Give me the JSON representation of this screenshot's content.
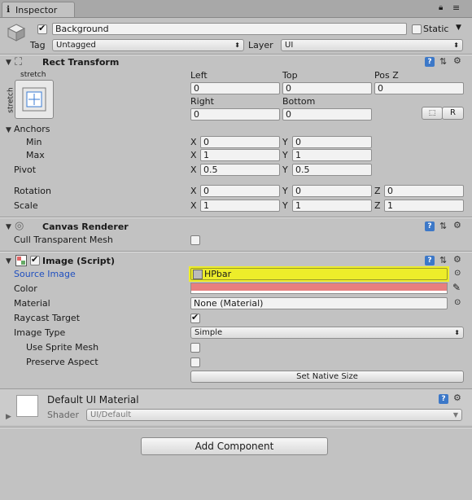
{
  "window": {
    "tab_label": "Inspector",
    "lock_icon": "lock-icon",
    "menu_icon": "context-menu-icon"
  },
  "object": {
    "name": "Background",
    "static_label": "Static",
    "tag_label": "Tag",
    "tag_value": "Untagged",
    "layer_label": "Layer",
    "layer_value": "UI"
  },
  "rect_transform": {
    "title": "Rect Transform",
    "anchor_preset_top": "stretch",
    "anchor_preset_side": "stretch",
    "left_label": "Left",
    "left": "0",
    "top_label": "Top",
    "top": "0",
    "posz_label": "Pos Z",
    "posz": "0",
    "right_label": "Right",
    "right": "0",
    "bottom_label": "Bottom",
    "bottom": "0",
    "r_button": "R",
    "anchors_label": "Anchors",
    "min_label": "Min",
    "min_x": "0",
    "min_y": "0",
    "max_label": "Max",
    "max_x": "1",
    "max_y": "1",
    "pivot_label": "Pivot",
    "pivot_x": "0.5",
    "pivot_y": "0.5",
    "rotation_label": "Rotation",
    "rot_x": "0",
    "rot_y": "0",
    "rot_z": "0",
    "scale_label": "Scale",
    "scale_x": "1",
    "scale_y": "1",
    "scale_z": "1",
    "x": "X",
    "y": "Y",
    "z": "Z"
  },
  "canvas_renderer": {
    "title": "Canvas Renderer",
    "cull_label": "Cull Transparent Mesh"
  },
  "image": {
    "title": "Image (Script)",
    "source_label": "Source Image",
    "source_value": "HPbar",
    "color_label": "Color",
    "color_value": "#e87f7f",
    "material_label": "Material",
    "material_value": "None (Material)",
    "raycast_label": "Raycast Target",
    "type_label": "Image Type",
    "type_value": "Simple",
    "sprite_mesh_label": "Use Sprite Mesh",
    "preserve_label": "Preserve Aspect",
    "native_size_button": "Set Native Size",
    "highlight_color": "#eded2a"
  },
  "material_section": {
    "title": "Default UI Material",
    "shader_label": "Shader",
    "shader_value": "UI/Default"
  },
  "add_component_button": "Add Component"
}
